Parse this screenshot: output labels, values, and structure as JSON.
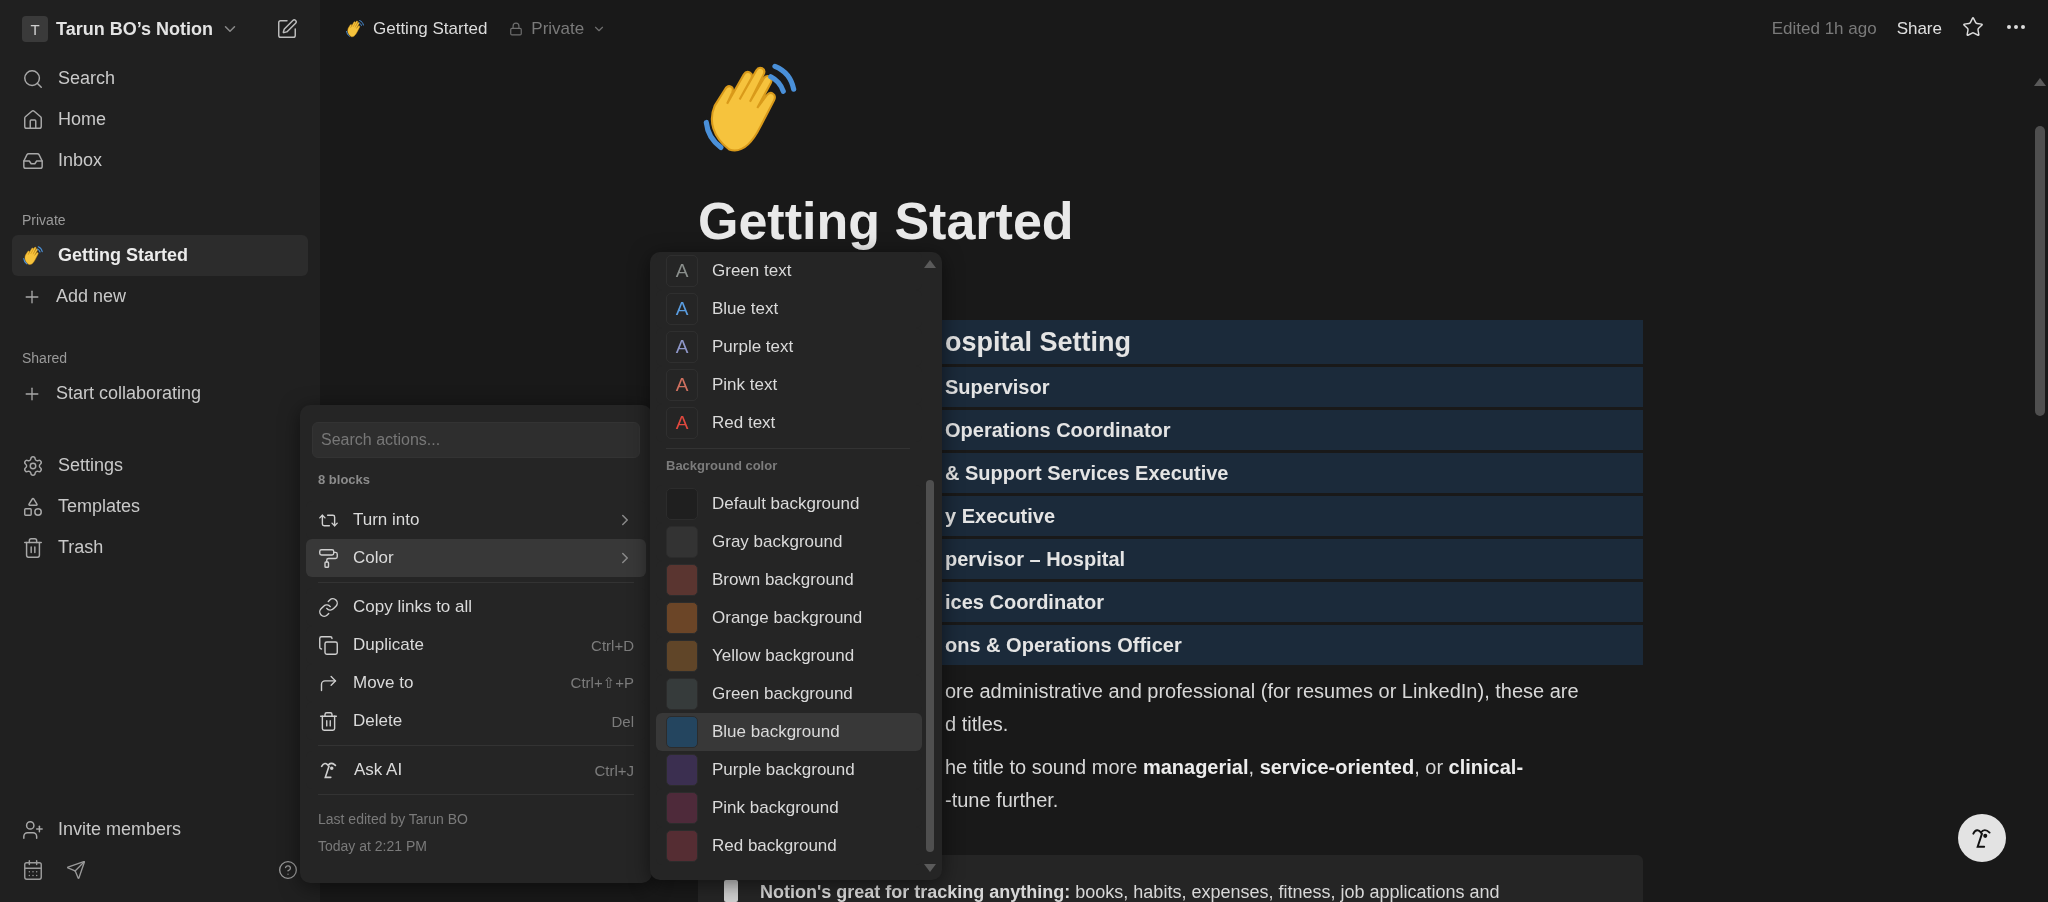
{
  "sidebar": {
    "workspace": {
      "initial": "T",
      "name": "Tarun BO’s Notion"
    },
    "nav": [
      {
        "label": "Search"
      },
      {
        "label": "Home"
      },
      {
        "label": "Inbox"
      }
    ],
    "sections": [
      {
        "title": "Private",
        "items": [
          {
            "label": "Getting Started",
            "kind": "page",
            "selected": true
          },
          {
            "label": "Add new",
            "kind": "action",
            "selected": false
          }
        ]
      },
      {
        "title": "Shared",
        "items": [
          {
            "label": "Start collaborating",
            "kind": "action",
            "selected": false
          }
        ]
      }
    ],
    "tools": [
      {
        "label": "Settings"
      },
      {
        "label": "Templates"
      },
      {
        "label": "Trash"
      }
    ],
    "invite": "Invite members"
  },
  "topbar": {
    "page_title": "Getting Started",
    "privacy": "Private",
    "edited": "Edited 1h ago",
    "share": "Share"
  },
  "page": {
    "title": "Getting Started",
    "blocks": [
      {
        "kind": "heading",
        "text": "ospital Setting"
      },
      {
        "kind": "item",
        "text": "Supervisor"
      },
      {
        "kind": "item",
        "text": "Operations Coordinator"
      },
      {
        "kind": "item",
        "text": "& Support Services Executive"
      },
      {
        "kind": "item",
        "text": "y Executive"
      },
      {
        "kind": "item",
        "text": "pervisor – Hospital"
      },
      {
        "kind": "item",
        "text": "ices Coordinator"
      },
      {
        "kind": "item",
        "text": "ons & Operations Officer"
      }
    ],
    "paragraphs": [
      [
        "ore administrative and professional (for resumes or LinkedIn), these are",
        "d titles."
      ],
      [
        "he title to sound more **managerial**, **service-oriented**, or **clinical-**",
        "-tune further."
      ]
    ],
    "callout": "**Notion's great for tracking anything:** books, habits, expenses, fitness, job applications and"
  },
  "block_menu": {
    "search_placeholder": "Search actions...",
    "count": "8 blocks",
    "groups": [
      [
        {
          "label": "Turn into",
          "submenu": true,
          "highlighted": false
        },
        {
          "label": "Color",
          "submenu": true,
          "highlighted": true
        }
      ],
      [
        {
          "label": "Copy links to all",
          "submenu": false,
          "highlighted": false
        },
        {
          "label": "Duplicate",
          "shortcut": "Ctrl+D",
          "submenu": false,
          "highlighted": false
        },
        {
          "label": "Move to",
          "shortcut": "Ctrl+⇧+P",
          "submenu": false,
          "highlighted": false
        },
        {
          "label": "Delete",
          "shortcut": "Del",
          "submenu": false,
          "highlighted": false
        }
      ],
      [
        {
          "label": "Ask AI",
          "shortcut": "Ctrl+J",
          "submenu": false,
          "highlighted": false
        }
      ]
    ],
    "footer": [
      "Last edited by Tarun BO",
      "Today at 2:21 PM"
    ]
  },
  "color_menu": {
    "text_colors": [
      {
        "label": "Green text",
        "glyph": "A",
        "color": "#8a8f8c"
      },
      {
        "label": "Blue text",
        "glyph": "A",
        "color": "#5a9de0"
      },
      {
        "label": "Purple text",
        "glyph": "A",
        "color": "#8f97c9"
      },
      {
        "label": "Pink text",
        "glyph": "A",
        "color": "#d0705f"
      },
      {
        "label": "Red text",
        "glyph": "A",
        "color": "#e0483e"
      }
    ],
    "background_title": "Background color",
    "backgrounds": [
      {
        "label": "Default background",
        "color": "#1f1f1f",
        "highlighted": false
      },
      {
        "label": "Gray background",
        "color": "#333333",
        "highlighted": false
      },
      {
        "label": "Brown background",
        "color": "#5a3530",
        "highlighted": false
      },
      {
        "label": "Orange background",
        "color": "#6b4527",
        "highlighted": false
      },
      {
        "label": "Yellow background",
        "color": "#604528",
        "highlighted": false
      },
      {
        "label": "Green background",
        "color": "#363b3b",
        "highlighted": false
      },
      {
        "label": "Blue background",
        "color": "#24455f",
        "highlighted": true
      },
      {
        "label": "Purple background",
        "color": "#3b2f50",
        "highlighted": false
      },
      {
        "label": "Pink background",
        "color": "#4e2a3a",
        "highlighted": false
      },
      {
        "label": "Red background",
        "color": "#552d33",
        "highlighted": false
      }
    ]
  }
}
